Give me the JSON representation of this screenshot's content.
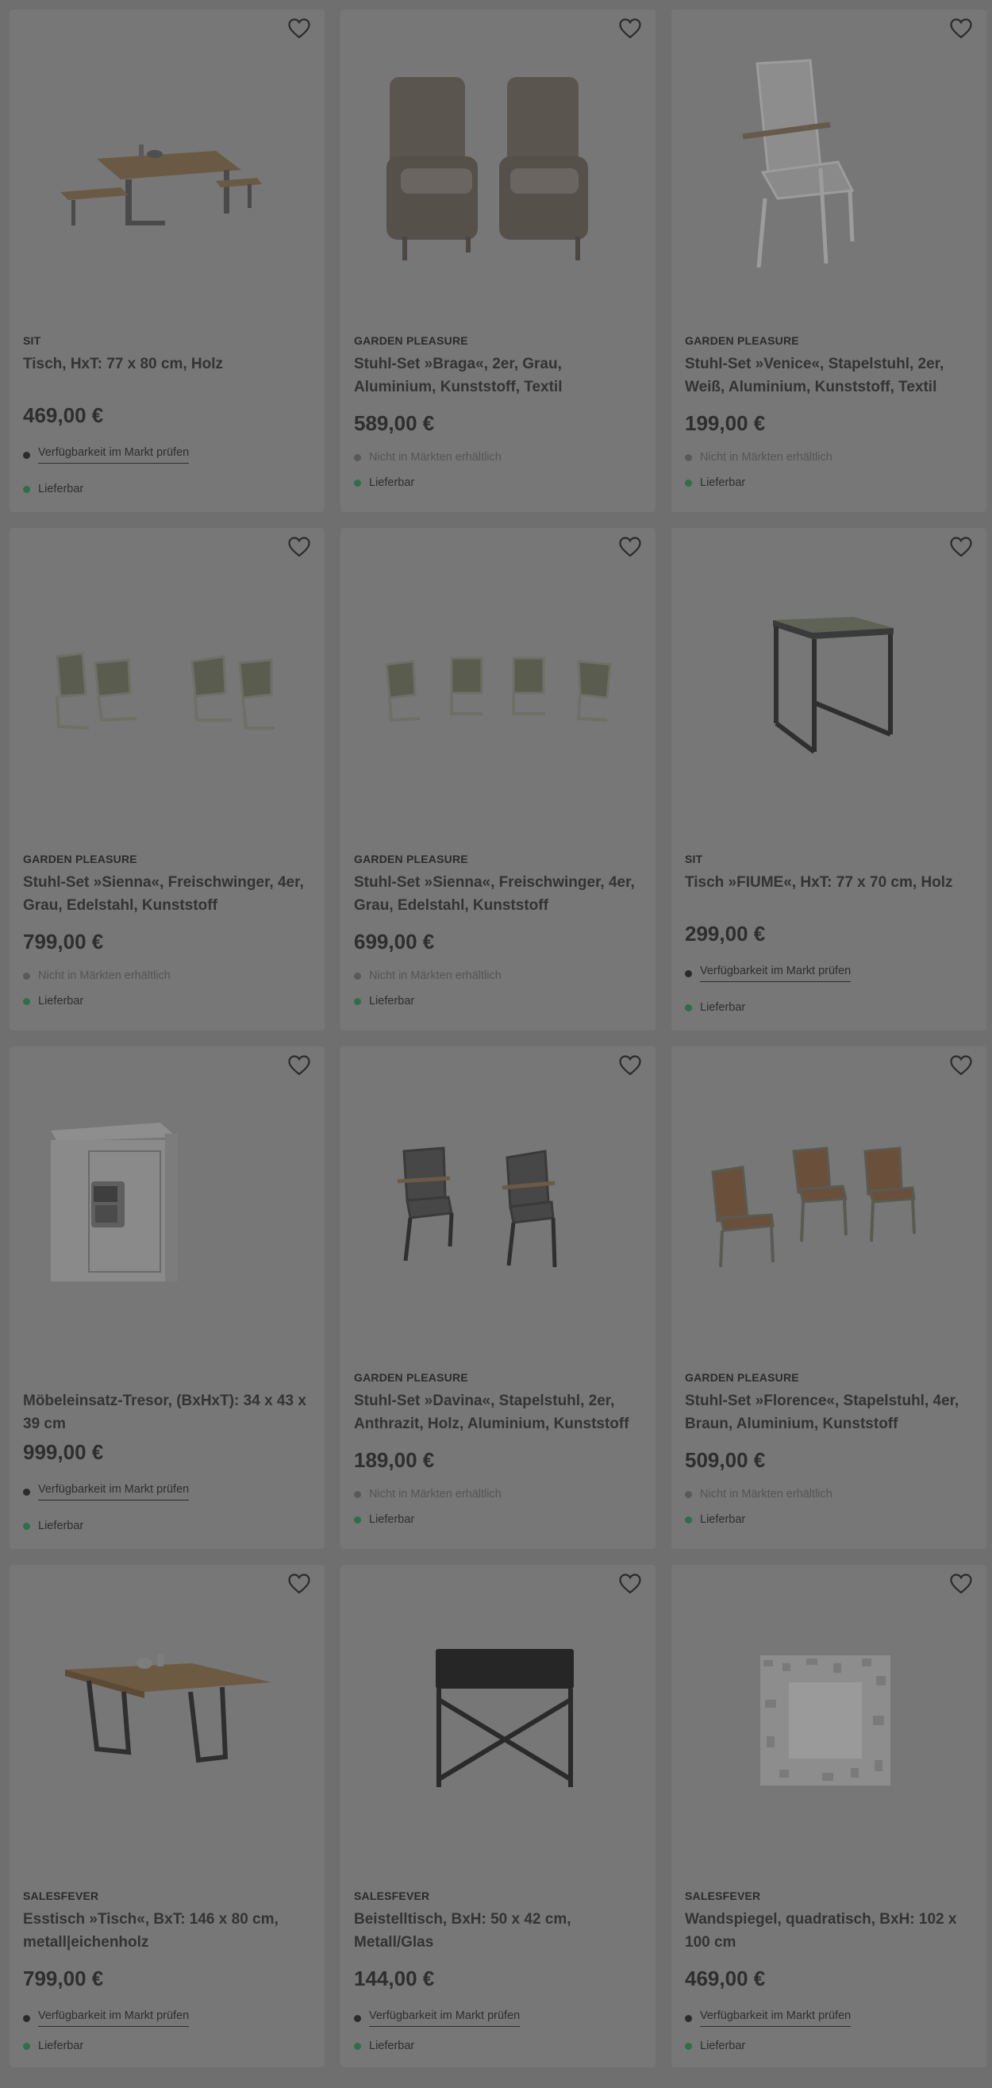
{
  "colors": {
    "overlay_bg": "#6f6f6f",
    "card_bg": "#777777",
    "available_green": "#2f6e4a"
  },
  "products": [
    {
      "brand": "SIT",
      "title": "Tisch, HxT: 77 x 80 cm, Holz",
      "price": "469,00 €",
      "store_text": "Verfügbarkeit im Markt prüfen",
      "store_check_link": true,
      "delivery": "Lieferbar",
      "image": "dining-table-with-benches"
    },
    {
      "brand": "GARDEN PLEASURE",
      "title": "Stuhl-Set »Braga«, 2er, Grau, Aluminium, Kunststoff, Textil",
      "price": "589,00 €",
      "store_text": "Nicht in Märkten erhältlich",
      "store_check_link": false,
      "delivery": "Lieferbar",
      "image": "two-wicker-armchairs"
    },
    {
      "brand": "GARDEN PLEASURE",
      "title": "Stuhl-Set »Venice«, Stapelstuhl, 2er, Weiß, Aluminium, Kunststoff, Textil",
      "price": "199,00 €",
      "store_text": "Nicht in Märkten erhältlich",
      "store_check_link": false,
      "delivery": "Lieferbar",
      "image": "white-stacking-chair"
    },
    {
      "brand": "GARDEN PLEASURE",
      "title": "Stuhl-Set »Sienna«, Freischwinger, 4er, Grau, Edelstahl, Kunststoff",
      "price": "799,00 €",
      "store_text": "Nicht in Märkten erhältlich",
      "store_check_link": false,
      "delivery": "Lieferbar",
      "image": "four-cantilever-chairs-angled"
    },
    {
      "brand": "GARDEN PLEASURE",
      "title": "Stuhl-Set »Sienna«, Freischwinger, 4er, Grau, Edelstahl, Kunststoff",
      "price": "699,00 €",
      "store_text": "Nicht in Märkten erhältlich",
      "store_check_link": false,
      "delivery": "Lieferbar",
      "image": "four-cantilever-chairs-row"
    },
    {
      "brand": "SIT",
      "title": "Tisch »FIUME«, HxT: 77 x 70 cm, Holz",
      "price": "299,00 €",
      "store_text": "Verfügbarkeit im Markt prüfen",
      "store_check_link": true,
      "delivery": "Lieferbar",
      "image": "square-bar-table"
    },
    {
      "brand": "",
      "title": "Möbeleinsatz-Tresor, (BxHxT): 34 x 43 x 39 cm",
      "price": "999,00 €",
      "store_text": "Verfügbarkeit im Markt prüfen",
      "store_check_link": true,
      "delivery": "Lieferbar",
      "image": "safe"
    },
    {
      "brand": "GARDEN PLEASURE",
      "title": "Stuhl-Set »Davina«, Stapelstuhl, 2er, Anthrazit, Holz, Aluminium, Kunststoff",
      "price": "189,00 €",
      "store_text": "Nicht in Märkten erhältlich",
      "store_check_link": false,
      "delivery": "Lieferbar",
      "image": "two-anthracite-chairs"
    },
    {
      "brand": "GARDEN PLEASURE",
      "title": "Stuhl-Set »Florence«, Stapelstuhl, 4er, Braun, Aluminium, Kunststoff",
      "price": "509,00 €",
      "store_text": "Nicht in Märkten erhältlich",
      "store_check_link": false,
      "delivery": "Lieferbar",
      "image": "brown-slatted-chairs"
    },
    {
      "brand": "SALESFEVER",
      "title": "Esstisch »Tisch«, BxT: 146 x 80 cm, metall|eichenholz",
      "price": "799,00 €",
      "store_text": "Verfügbarkeit im Markt prüfen",
      "store_check_link": true,
      "delivery": "Lieferbar",
      "image": "oak-dining-table"
    },
    {
      "brand": "SALESFEVER",
      "title": "Beistelltisch, BxH: 50 x 42 cm, Metall/Glas",
      "price": "144,00 €",
      "store_text": "Verfügbarkeit im Markt prüfen",
      "store_check_link": true,
      "delivery": "Lieferbar",
      "image": "marble-side-table"
    },
    {
      "brand": "SALESFEVER",
      "title": "Wandspiegel, quadratisch, BxH: 102 x 100 cm",
      "price": "469,00 €",
      "store_text": "Verfügbarkeit im Markt prüfen",
      "store_check_link": true,
      "delivery": "Lieferbar",
      "image": "square-wall-mirror"
    }
  ]
}
